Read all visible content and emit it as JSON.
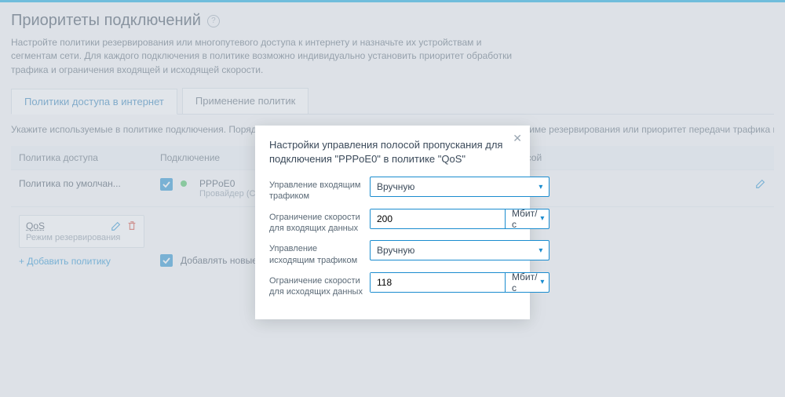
{
  "header": {
    "title": "Приоритеты подключений",
    "help_symbol": "?",
    "description": "Настройте политики резервирования или многопутевого доступа к интернету и назначьте их устройствам и сегментам сети. Для каждого подключения в политике возможно индивидуально установить приоритет обработки трафика и ограничения входящей и исходящей скорости."
  },
  "tabs": {
    "access": "Политики доступа в интернет",
    "apply": "Применение политик"
  },
  "instruction": "Укажите используемые в политике подключения. Порядок расстановки определяет очередность использования в режиме резервирования или приоритет передачи трафика в режиме многопутевой политики. Системная политика по умолчанию всегда работ",
  "columns": {
    "policy": "Политика доступа",
    "connection": "Подключение",
    "bandwidth": "осой"
  },
  "policies": {
    "default_name": "Политика по умолчан...",
    "qos_name": "QoS",
    "qos_mode": "Режим резервирования",
    "add": "+ Добавить политику"
  },
  "connection": {
    "name": "PPPoE0",
    "desc": "Провайдер (Сеть Ethernet",
    "add_new": "Добавлять новые подключени"
  },
  "modal": {
    "title": "Настройки управления полосой пропускания для подключения \"PPPoE0\" в политике \"QoS\"",
    "fields": {
      "inbound_mgmt_label": "Управление входящим трафиком",
      "inbound_mgmt_value": "Вручную",
      "inbound_limit_label": "Ограничение скорости для входящих данных",
      "inbound_limit_value": "200",
      "outbound_mgmt_label": "Управление исходящим трафиком",
      "outbound_mgmt_value": "Вручную",
      "outbound_limit_label": "Ограничение скорости для исходящих данных",
      "outbound_limit_value": "118",
      "unit": "Мбит/с"
    }
  }
}
